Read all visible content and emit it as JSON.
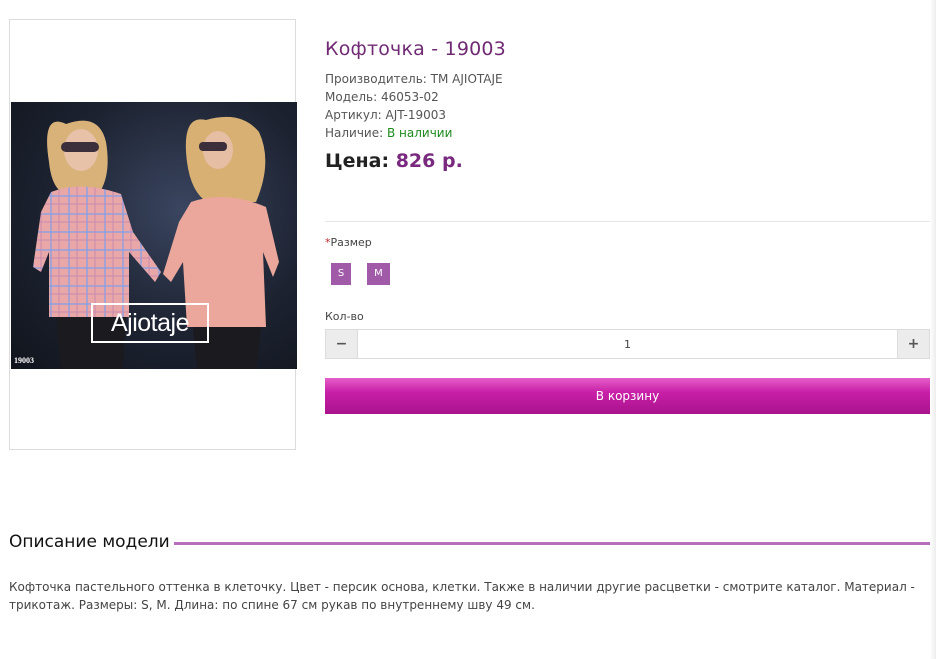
{
  "product": {
    "title": "Кофточка - 19003",
    "manufacturer_label": "Производитель:",
    "manufacturer_value": "ТМ AJIOTAJE",
    "model_label": "Модель:",
    "model_value": "46053-02",
    "sku_label": "Артикул:",
    "sku_value": "AJT-19003",
    "availability_label": "Наличие:",
    "availability_value": "В наличии",
    "price_label": "Цена:",
    "price_value": "826 р."
  },
  "image": {
    "brand": "Ajiotaje",
    "code": "19003"
  },
  "options": {
    "required_mark": "*",
    "size_label": "Размер",
    "sizes": [
      "S",
      "M"
    ],
    "qty_label": "Кол-во",
    "qty_minus": "−",
    "qty_plus": "+",
    "qty_value": "1",
    "add_to_cart": "В корзину"
  },
  "description": {
    "heading": "Описание модели",
    "text": "Кофточка пастельного оттенка в клеточку. Цвет - персик основа, клетки. Также в наличии другие расцветки - смотрите каталог. Материал - трикотаж. Размеры: S, M. Длина: по спине 67 см рукав по внутреннему шву 49 см."
  },
  "colors": {
    "title": "#6f2a73",
    "price": "#7a2a7e",
    "in_stock": "#1d8a1d",
    "size_button": "#a05aa8",
    "cart_button": "#c81fa7",
    "rule": "#b56fbc"
  }
}
